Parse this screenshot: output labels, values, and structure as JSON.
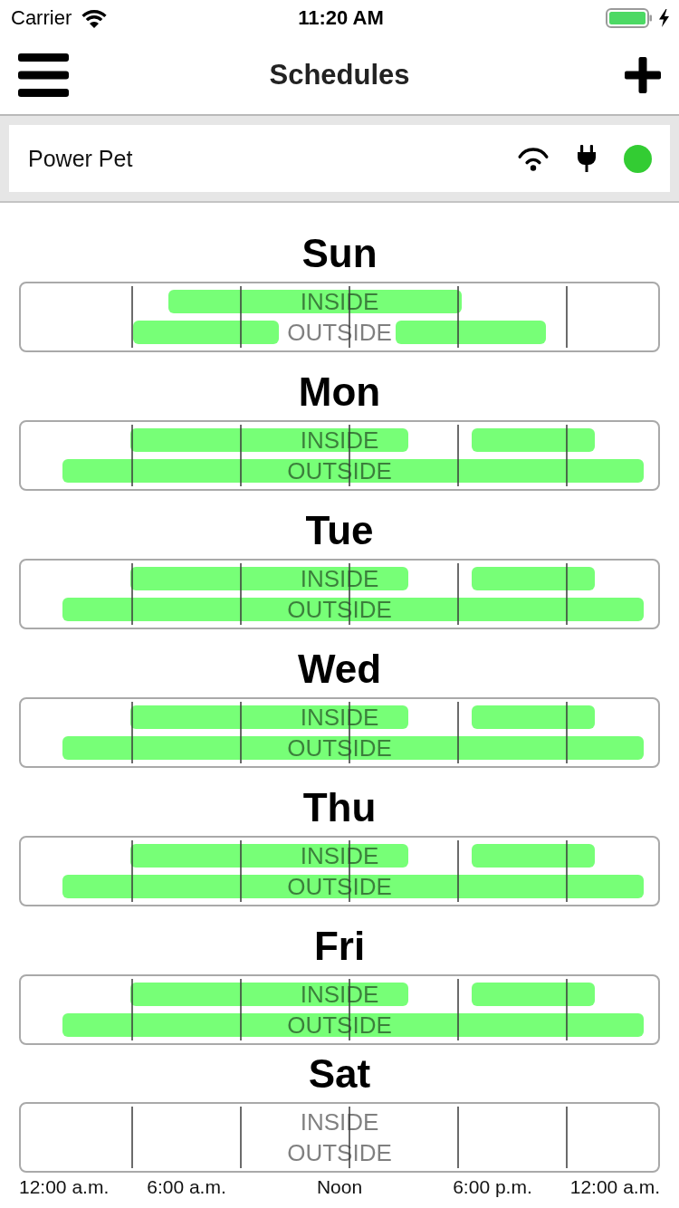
{
  "status_bar": {
    "carrier": "Carrier",
    "time": "11:20 AM"
  },
  "nav_bar": {
    "title": "Schedules"
  },
  "device": {
    "name": "Power Pet",
    "online": true
  },
  "days": [
    {
      "name": "Sun",
      "kind": "split",
      "rows": [
        "INSIDE",
        "OUTSIDE"
      ]
    },
    {
      "name": "Mon",
      "kind": "full",
      "rows": [
        "INSIDE",
        "OUTSIDE"
      ]
    },
    {
      "name": "Tue",
      "kind": "full",
      "rows": [
        "INSIDE",
        "OUTSIDE"
      ]
    },
    {
      "name": "Wed",
      "kind": "full",
      "rows": [
        "INSIDE",
        "OUTSIDE"
      ]
    },
    {
      "name": "Thu",
      "kind": "full",
      "rows": [
        "INSIDE",
        "OUTSIDE"
      ]
    },
    {
      "name": "Fri",
      "kind": "full",
      "rows": [
        "INSIDE",
        "OUTSIDE"
      ]
    },
    {
      "name": "Sat",
      "kind": "empty",
      "rows": [
        "INSIDE",
        "OUTSIDE"
      ]
    }
  ],
  "time_axis": [
    "12:00 a.m.",
    "6:00 a.m.",
    "Noon",
    "6:00 p.m.",
    "12:00 a.m."
  ]
}
